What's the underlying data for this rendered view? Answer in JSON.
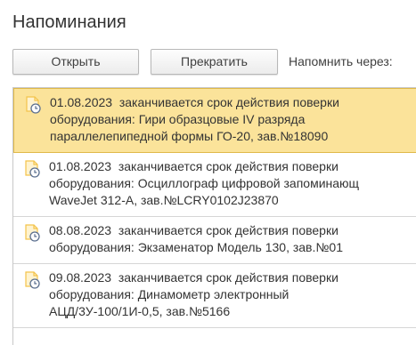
{
  "window": {
    "title": "Напоминания"
  },
  "toolbar": {
    "open_label": "Открыть",
    "stop_label": "Прекратить",
    "remind_label": "Напомнить через:"
  },
  "colors": {
    "selected_background": "#fbe39a",
    "selected_border": "#e0b94a",
    "icon_sheet": "#f3c34a",
    "icon_clock": "#5b6f8f"
  },
  "reminders": [
    {
      "icon": "reminder-clock-icon",
      "selected": true,
      "lines": [
        "01.08.2023  заканчивается срок действия поверки",
        "оборудования: Гири образцовые IV разряда",
        "параллелепипедной формы ГО-20, зав.№18090"
      ]
    },
    {
      "icon": "reminder-clock-icon",
      "selected": false,
      "lines": [
        "01.08.2023  заканчивается срок действия поверки",
        "оборудования: Осциллограф цифровой запоминающ",
        "WaveJet 312-A, зав.№LCRY0102J23870"
      ]
    },
    {
      "icon": "reminder-clock-icon",
      "selected": false,
      "lines": [
        "08.08.2023  заканчивается срок действия поверки",
        "оборудования: Экзаменатор Модель 130, зав.№01"
      ]
    },
    {
      "icon": "reminder-clock-icon",
      "selected": false,
      "lines": [
        "09.08.2023  заканчивается срок действия поверки",
        "оборудования: Динамометр электронный",
        "АЦД/3У-100/1И-0,5, зав.№5166"
      ]
    }
  ]
}
